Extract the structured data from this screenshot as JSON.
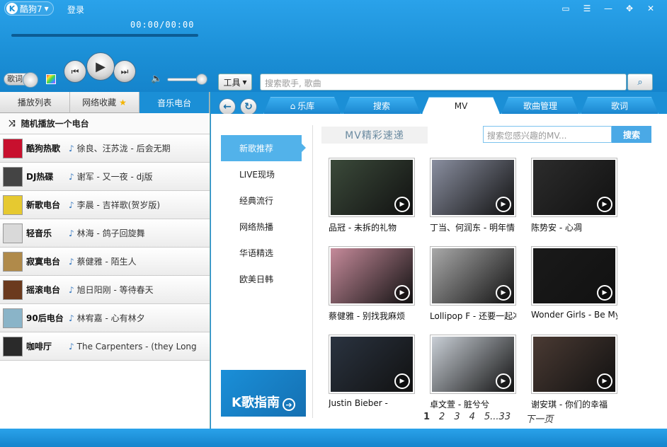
{
  "app": {
    "brand": "酷狗7",
    "login": "登录",
    "time": "00:00/00:00"
  },
  "player": {
    "lyric_toggle": "歌词"
  },
  "toolbar": {
    "tools_label": "工具",
    "search_placeholder": "搜索歌手, 歌曲"
  },
  "left_tabs": [
    {
      "label": "播放列表"
    },
    {
      "label": "网络收藏"
    },
    {
      "label": "音乐电台"
    }
  ],
  "random_play": "随机播放一个电台",
  "radios": [
    {
      "name": "酷狗热歌",
      "song": "徐良、汪苏泷 - 后会无期",
      "color": "#c8102e"
    },
    {
      "name": "DJ热碟",
      "song": "谢军 - 又一夜 - dj版",
      "color": "#444444"
    },
    {
      "name": "新歌电台",
      "song": "李晨 - 吉祥歌(贺岁版)",
      "color": "#e6c930"
    },
    {
      "name": "轻音乐",
      "song": "林海 - 鸽子回旋舞",
      "color": "#d9d9d9"
    },
    {
      "name": "寂寞电台",
      "song": "蔡健雅 - 陌生人",
      "color": "#b08a4a"
    },
    {
      "name": "摇滚电台",
      "song": "旭日阳刚 - 等待春天",
      "color": "#6b3a1e"
    },
    {
      "name": "90后电台",
      "song": "林宥嘉 - 心有林夕",
      "color": "#8ab4c8"
    },
    {
      "name": "咖啡厅",
      "song": "The Carpenters - (they Long",
      "color": "#2a2a2a"
    }
  ],
  "main_tabs": [
    {
      "label": "乐库"
    },
    {
      "label": "搜索"
    },
    {
      "label": "MV"
    },
    {
      "label": "歌曲管理"
    },
    {
      "label": "歌词"
    }
  ],
  "categories": [
    "新歌推荐",
    "LIVE现场",
    "经典流行",
    "网络热播",
    "华语精选",
    "欧美日韩"
  ],
  "k_guide": "K歌指南",
  "mv": {
    "title": "MV精彩速递",
    "search_placeholder": "搜索您感兴趣的MV...",
    "search_button": "搜索",
    "items": [
      {
        "caption": "品冠 - 未拆的礼物",
        "color": "#3b4a3a"
      },
      {
        "caption": "丁当、何润东 - 明年情",
        "color": "#8a8fa0"
      },
      {
        "caption": "陈势安 - 心凋",
        "color": "#2c2c2c"
      },
      {
        "caption": "蔡健雅 - 别找我麻烦",
        "color": "#c58a9a"
      },
      {
        "caption": "Lollipop F - 还要一起冲",
        "color": "#a9a9a9"
      },
      {
        "caption": "Wonder Girls - Be My",
        "color": "#1a1a1a"
      },
      {
        "caption": "Justin Bieber -",
        "color": "#2a3340"
      },
      {
        "caption": "卓文萱 - 脏兮兮",
        "color": "#c9cfd6"
      },
      {
        "caption": "谢安琪 - 你们的幸福",
        "color": "#4a3a33"
      }
    ]
  },
  "pager": {
    "pages": [
      "1",
      "2",
      "3",
      "4",
      "5...33"
    ],
    "next": "下一页"
  }
}
